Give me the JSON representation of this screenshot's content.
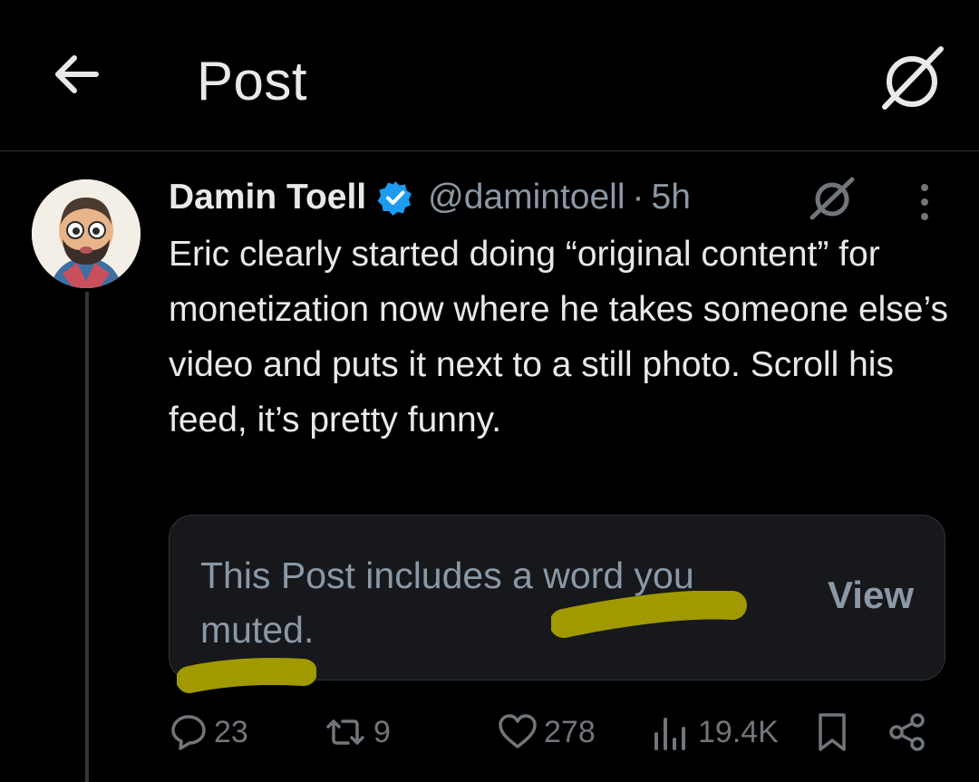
{
  "header": {
    "title": "Post",
    "back_icon": "arrow-left-icon",
    "grok_icon": "grok-slash-icon"
  },
  "post": {
    "author_name": "Damin Toell",
    "handle": "@damintoell",
    "separator": "·",
    "time": "5h",
    "verified_color": "#1d9bf0",
    "text": "Eric clearly started doing “original content” for monetization now where he takes someone else’s video and puts it next to a still photo. Scroll his feed, it’s pretty funny.",
    "muted_notice": "This Post includes a word you muted.",
    "view_label": "View",
    "highlight_color": "#a09a00"
  },
  "actions": {
    "replies": "23",
    "reposts": "9",
    "likes": "278",
    "views": "19.4K"
  }
}
